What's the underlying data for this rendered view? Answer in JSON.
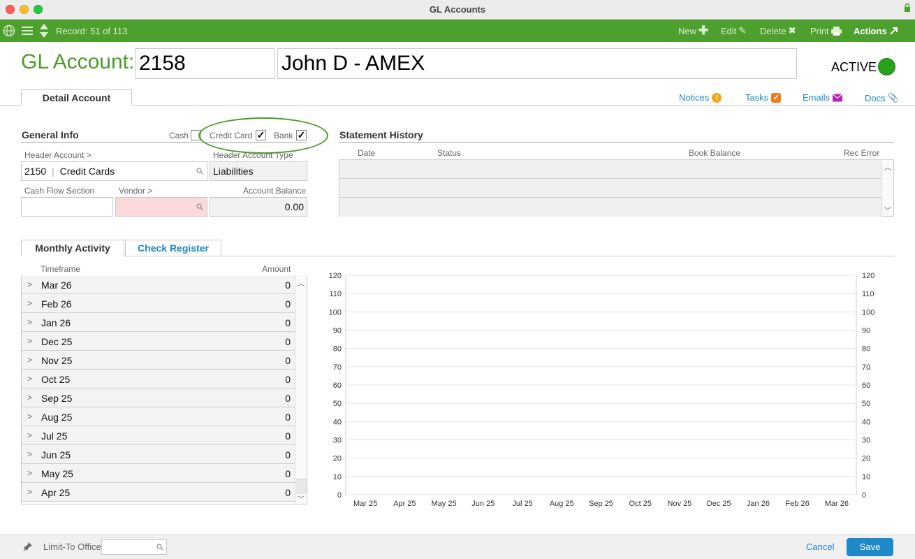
{
  "window": {
    "title": "GL Accounts"
  },
  "toolbar": {
    "record": "Record: 51 of 113",
    "new_label": "New",
    "edit_label": "Edit",
    "delete_label": "Delete",
    "print_label": "Print",
    "actions_label": "Actions"
  },
  "header": {
    "label": "GL Account:",
    "account_number": "2158",
    "account_name": "John D - AMEX",
    "status": "ACTIVE",
    "status_color": "#28a21c"
  },
  "tabs": {
    "detail": "Detail Account",
    "notices": "Notices",
    "tasks": "Tasks",
    "emails": "Emails",
    "docs": "Docs"
  },
  "general_info": {
    "title": "General Info",
    "cash_label": "Cash",
    "cash_checked": false,
    "credit_card_label": "Credit Card",
    "credit_card_checked": true,
    "bank_label": "Bank",
    "bank_checked": true,
    "header_account_label": "Header Account >",
    "header_account_code": "2150",
    "header_account_name": "Credit Cards",
    "header_account_type_label": "Header Account Type",
    "header_account_type": "Liabilities",
    "cash_flow_label": "Cash Flow Section",
    "cash_flow_value": "",
    "vendor_label": "Vendor >",
    "vendor_value": "",
    "balance_label": "Account Balance",
    "balance_value": "0.00"
  },
  "statement_history": {
    "title": "Statement History",
    "columns": [
      "Date",
      "Status",
      "Book Balance",
      "Rec Error"
    ],
    "rows": []
  },
  "lower_tabs": {
    "monthly": "Monthly Activity",
    "check": "Check Register"
  },
  "monthly_activity": {
    "col_timeframe": "Timeframe",
    "col_amount": "Amount",
    "rows": [
      {
        "timeframe": "Mar 26",
        "amount": "0"
      },
      {
        "timeframe": "Feb 26",
        "amount": "0"
      },
      {
        "timeframe": "Jan 26",
        "amount": "0"
      },
      {
        "timeframe": "Dec 25",
        "amount": "0"
      },
      {
        "timeframe": "Nov 25",
        "amount": "0"
      },
      {
        "timeframe": "Oct 25",
        "amount": "0"
      },
      {
        "timeframe": "Sep 25",
        "amount": "0"
      },
      {
        "timeframe": "Aug 25",
        "amount": "0"
      },
      {
        "timeframe": "Jul 25",
        "amount": "0"
      },
      {
        "timeframe": "Jun 25",
        "amount": "0"
      },
      {
        "timeframe": "May 25",
        "amount": "0"
      },
      {
        "timeframe": "Apr 25",
        "amount": "0"
      }
    ]
  },
  "chart_data": {
    "type": "bar",
    "categories": [
      "Mar 25",
      "Apr 25",
      "May 25",
      "Jun 25",
      "Jul 25",
      "Aug 25",
      "Sep 25",
      "Oct 25",
      "Nov 25",
      "Dec 25",
      "Jan 26",
      "Feb 26",
      "Mar 26"
    ],
    "values": [
      0,
      0,
      0,
      0,
      0,
      0,
      0,
      0,
      0,
      0,
      0,
      0,
      0
    ],
    "yticks": [
      0,
      10,
      20,
      30,
      40,
      50,
      60,
      70,
      80,
      90,
      100,
      110,
      120
    ],
    "ylim": [
      0,
      120
    ],
    "grid": true,
    "title": "",
    "xlabel": "",
    "ylabel": ""
  },
  "footer": {
    "limit_label": "Limit-To Office",
    "limit_value": "",
    "cancel_label": "Cancel",
    "save_label": "Save"
  },
  "colors": {
    "toolbar": "#4ea02e",
    "brand_green": "#4a9d2a",
    "link_blue": "#1e88c8"
  }
}
